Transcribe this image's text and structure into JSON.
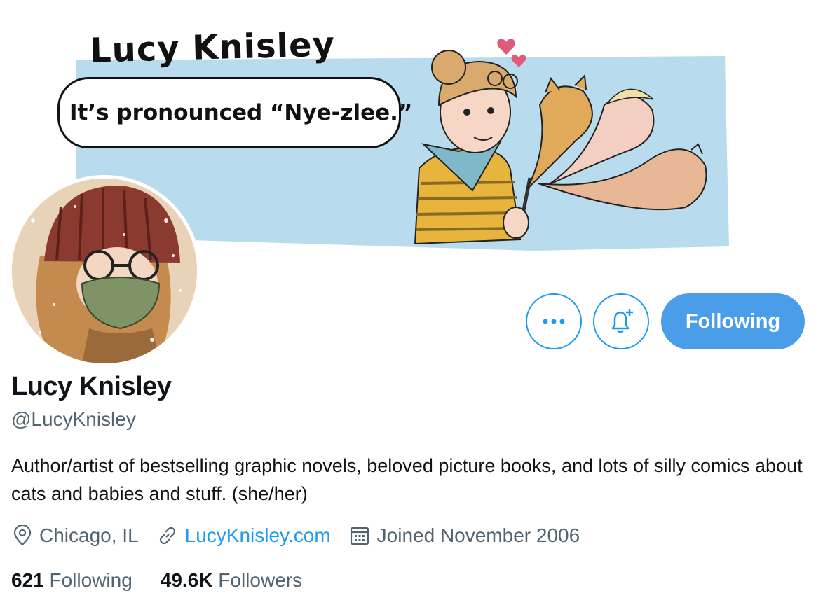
{
  "banner": {
    "title": "Lucy Knisley",
    "speech": "It’s pronounced “Nye-zlee.”"
  },
  "profile": {
    "display_name": "Lucy Knisley",
    "handle": "@LucyKnisley",
    "bio": "Author/artist of bestselling graphic novels, beloved picture books, and lots of silly comics about cats and babies and stuff. (she/her)",
    "location": "Chicago, IL",
    "website": "LucyKnisley.com",
    "joined": "Joined November 2006"
  },
  "actions": {
    "following_label": "Following"
  },
  "stats": {
    "following_count": "621",
    "following_label": "Following",
    "followers_count": "49.6K",
    "followers_label": "Followers"
  },
  "colors": {
    "accent": "#1d9bf0",
    "button_fill": "#4a9de8",
    "banner_blue": "#b8dcee",
    "secondary_text": "#536471"
  },
  "icons": [
    "more-icon",
    "notification-bell-plus-icon",
    "location-pin-icon",
    "link-icon",
    "calendar-icon"
  ]
}
